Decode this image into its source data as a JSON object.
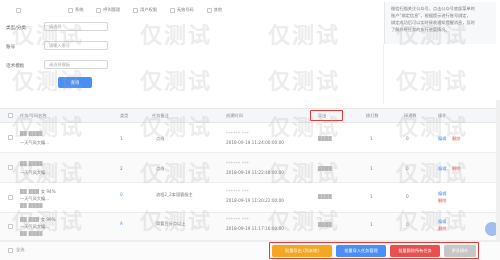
{
  "filters": {
    "checkbox_options": [
      "",
      "系统",
      "呼叫管理",
      "用户权限",
      "无效号码",
      "其他"
    ],
    "type_label": "类型/分类",
    "type_placeholder": "请选择",
    "account_label": "账号",
    "account_placeholder": "请输入账号",
    "template_label": "话术模板",
    "template_placeholder": "请选择模板",
    "query_button": "查询"
  },
  "notice": {
    "lines": [
      "微信扫描关注公众号，点击公众号底部菜单的",
      "账户“绑定信息”，根据提示进行账号绑定，",
      "绑定成功后可以实时接收通知提醒消息，及时",
      "了解外呼任务的执行进度情况。"
    ]
  },
  "table": {
    "headers": [
      "任务/号码名称",
      "类型",
      "任务备注",
      "创建时间",
      "导出",
      "拨打数",
      "接通数",
      "操作"
    ],
    "rows": [
      {
        "name": "一天气风大编...",
        "sub": "",
        "type": "1",
        "remark": "点线",
        "time": "2018-09-19 11:24:00:00:00",
        "masked": "****** ***",
        "calls": "1",
        "connected": "0",
        "edit": "编辑",
        "delete": "删除"
      },
      {
        "name": "一天气风大编...",
        "sub": "",
        "type": "2",
        "remark": "点线",
        "time": "2018-09-19 11:22:48:00:00",
        "masked": "****** ***",
        "calls": "1",
        "connected": "0",
        "edit": "编辑",
        "delete": "删除"
      },
      {
        "name": "女 94%",
        "sub": "一天气风大编...",
        "type": "0",
        "remark": "流程2_2本国客服主",
        "time": "2018-09-19 11:20:22:00:00",
        "masked": "****** ***",
        "calls": "1",
        "connected": "0",
        "edit": "编辑",
        "delete": "删除"
      },
      {
        "name": "女 99%",
        "sub": "一天气风大编...",
        "type": "A",
        "remark": "简要百分点以上",
        "time": "2018-09-19 11:17:16:00:00",
        "masked": "****** ***",
        "calls": "1",
        "connected": "0",
        "edit": "编辑",
        "delete": "删除"
      }
    ]
  },
  "bottom_actions": {
    "select_all": "全选",
    "buttons": [
      "批量导出 (到本地)",
      "批量导入任务管理",
      "批量删除所有任务",
      "更多操作"
    ]
  },
  "watermark": "仅测试",
  "colors": {
    "primary": "#4a8ff5",
    "danger": "#e85050",
    "highlight": "#e53935",
    "orange": "#f5a623",
    "red": "#e8504f"
  }
}
